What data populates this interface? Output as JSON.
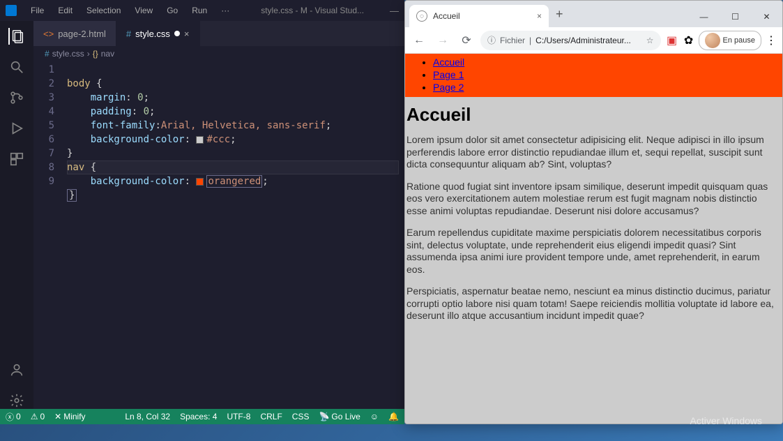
{
  "vscode": {
    "menubar": [
      "File",
      "Edit",
      "Selection",
      "View",
      "Go",
      "Run",
      "···"
    ],
    "title": "style.css - M - Visual Stud...",
    "tabs": [
      {
        "icon": "<>",
        "label": "page-2.html",
        "active": false
      },
      {
        "icon": "#",
        "label": "style.css",
        "active": true
      }
    ],
    "breadcrumb": {
      "file": "style.css",
      "symbol": "nav"
    },
    "lines": [
      "1",
      "2",
      "3",
      "4",
      "5",
      "6",
      "7",
      "8",
      "9"
    ],
    "code": {
      "l1_sel": "body",
      "l1_brace": " {",
      "l2_prop": "margin",
      "l2_val": "0",
      "l3_prop": "padding",
      "l3_val": "0",
      "l4_prop": "font-family",
      "l4_val": "Arial, Helvetica, sans-serif",
      "l5_prop": "background-color",
      "l5_color": "#ccc",
      "l5_val": "#ccc",
      "l6": "}",
      "l7_sel": "nav",
      "l7_brace": " {",
      "l8_prop": "background-color",
      "l8_color": "#ff4500",
      "l8_val": "orangered",
      "l9": "}"
    },
    "status": {
      "errors": "0",
      "warnings": "0",
      "minify": "Minify",
      "ln_col": "Ln 8, Col 32",
      "spaces": "Spaces: 4",
      "encoding": "UTF-8",
      "eol": "CRLF",
      "lang": "CSS",
      "golive": "Go Live"
    }
  },
  "chrome": {
    "tab_title": "Accueil",
    "addr_scheme_label": "Fichier",
    "addr_path": "C:/Users/Administrateur...",
    "pause_label": "En pause",
    "nav_items": [
      "Accueil",
      "Page 1",
      "Page 2"
    ],
    "heading": "Accueil",
    "paragraphs": [
      "Lorem ipsum dolor sit amet consectetur adipisicing elit. Neque adipisci in illo ipsum perferendis labore error distinctio repudiandae illum et, sequi repellat, suscipit sunt dicta consequuntur aliquam ab? Sint, voluptas?",
      "Ratione quod fugiat sint inventore ipsam similique, deserunt impedit quisquam quas eos vero exercitationem autem molestiae rerum est fugit magnam nobis distinctio esse animi voluptas repudiandae. Deserunt nisi dolore accusamus?",
      "Earum repellendus cupiditate maxime perspiciatis dolorem necessitatibus corporis sint, delectus voluptate, unde reprehenderit eius eligendi impedit quasi? Sint assumenda ipsa animi iure provident tempore unde, amet reprehenderit, in earum eos.",
      "Perspiciatis, aspernatur beatae nemo, nesciunt ea minus distinctio ducimus, pariatur corrupti optio labore nisi quam totam! Saepe reiciendis mollitia voluptate id labore ea, deserunt illo atque accusantium incidunt impedit quae?"
    ]
  },
  "watermark": {
    "line1": "Activer Windows"
  }
}
